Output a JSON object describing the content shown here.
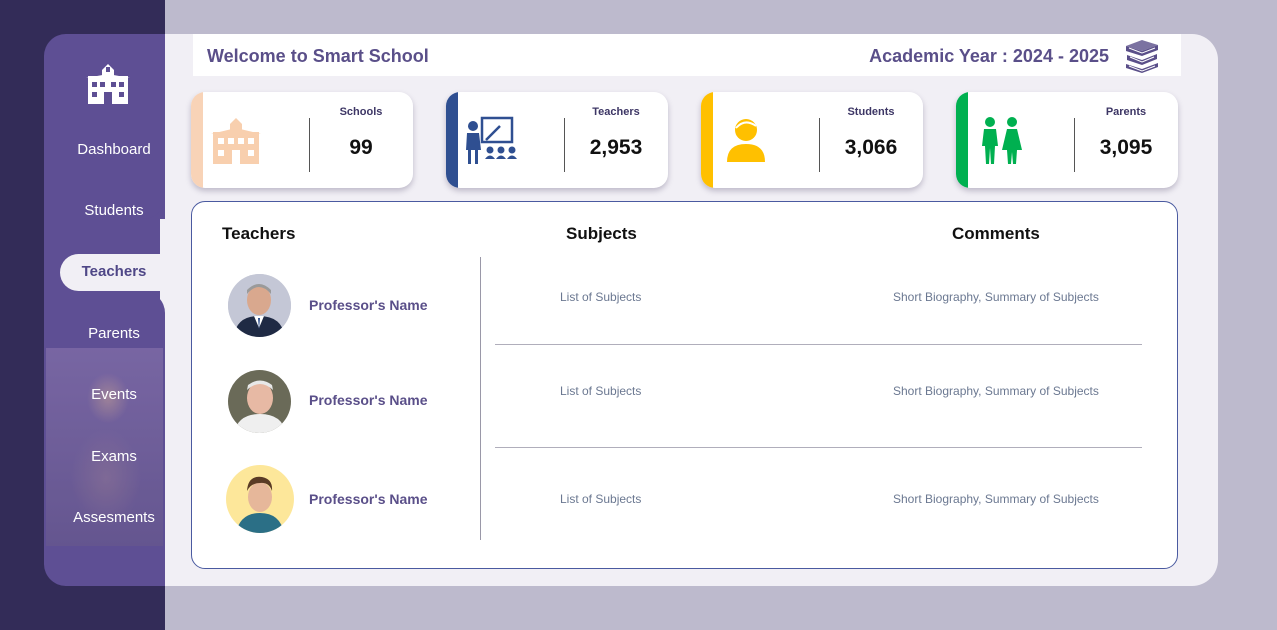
{
  "header": {
    "title": "Welcome to Smart School",
    "academic_year": "Academic Year : 2024 - 2025"
  },
  "sidebar": {
    "items": [
      {
        "label": "Dashboard"
      },
      {
        "label": "Students"
      },
      {
        "label": "Teachers"
      },
      {
        "label": "Parents"
      },
      {
        "label": "Events"
      },
      {
        "label": "Exams"
      },
      {
        "label": "Assesments"
      }
    ],
    "active": "Teachers"
  },
  "stats": [
    {
      "label": "Schools",
      "value": "99",
      "accent": "#f8d3b7",
      "icon": "school-icon"
    },
    {
      "label": "Teachers",
      "value": "2,953",
      "accent": "#2f4f91",
      "icon": "teacher-icon"
    },
    {
      "label": "Students",
      "value": "3,066",
      "accent": "#ffc000",
      "icon": "student-icon"
    },
    {
      "label": "Parents",
      "value": "3,095",
      "accent": "#00b050",
      "icon": "parents-icon"
    }
  ],
  "table": {
    "headers": {
      "teachers": "Teachers",
      "subjects": "Subjects",
      "comments": "Comments"
    },
    "rows": [
      {
        "name": "Professor's Name",
        "subjects": "List of Subjects",
        "comments": "Short Biography, Summary of Subjects"
      },
      {
        "name": "Professor's Name",
        "subjects": "List of Subjects",
        "comments": "Short Biography, Summary of Subjects"
      },
      {
        "name": "Professor's Name",
        "subjects": "List of Subjects",
        "comments": "Short Biography, Summary of Subjects"
      }
    ]
  },
  "colors": {
    "brand_dark": "#332c58",
    "sidebar": "#5e4f94",
    "title_text": "#5a4f89"
  }
}
